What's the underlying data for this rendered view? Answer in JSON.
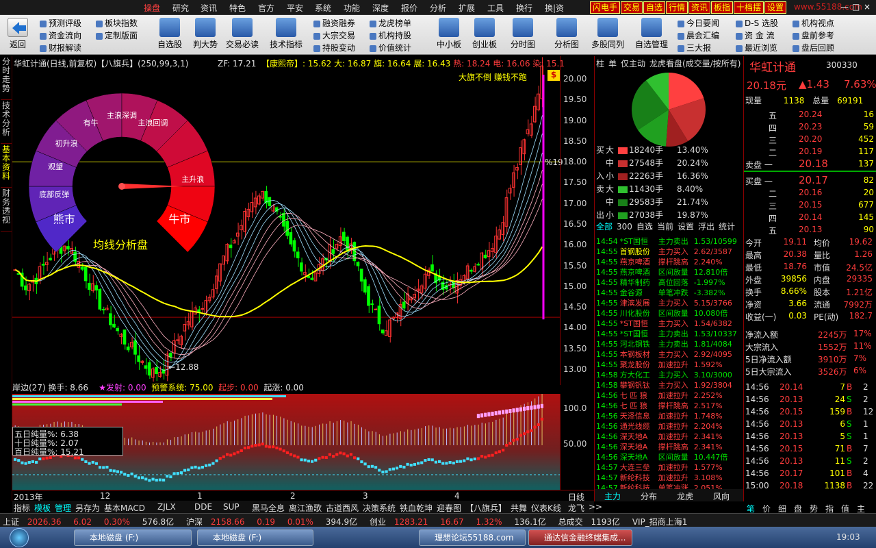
{
  "menu": {
    "items": [
      "操盘",
      "研究",
      "资讯",
      "特色",
      "官方",
      "平安",
      "系统",
      "功能",
      "深度",
      "报价",
      "分析",
      "扩展",
      "工具",
      "换行",
      "换|资"
    ],
    "right_buttons": [
      "闪电手",
      "交易",
      "自选",
      "行情",
      "资讯",
      "板指",
      "十档摆",
      "设置"
    ],
    "watermark": "www.55188.com",
    "window_controls": [
      "—",
      "□",
      "×"
    ]
  },
  "toolbar": {
    "back": "返回",
    "smalls": [
      [
        "预测评级",
        "资金流向",
        "财报解读"
      ],
      [
        "板块指数",
        "定制版面"
      ],
      [
        "融资融券",
        "大宗交易",
        "持股变动"
      ],
      [
        "龙虎榜单",
        "机构持股",
        "价值统计"
      ],
      [
        "今日要闻",
        "晨会汇编",
        "三大报"
      ],
      [
        "D-S 选股",
        "资 金 流",
        "最近浏览"
      ],
      [
        "机构视点",
        "盘前参考",
        "盘后回顾"
      ]
    ],
    "bigs": [
      "自选股",
      "判大势",
      "交易必读",
      "技术指标",
      "中小板",
      "创业板",
      "分时图",
      "分析图",
      "多股同列",
      "自选管理"
    ]
  },
  "left_tabs": [
    "分时走势",
    "技术分析",
    "基本资料",
    "财务透视"
  ],
  "chart": {
    "title": "华虹计通(日线,前复权)【八旗兵】(250,99,3,1)",
    "zf": "ZF: 17.21",
    "kangxi": "【康熙帝】: 15.62",
    "da": "大: 16.87",
    "qi": "旗: 16.64",
    "zhan": "展: 16.43",
    "re": "热: 18.24",
    "dian": "电: 16.06",
    "ran": "染: 15.1",
    "slogan": "大旗不倒 赚钱不跑",
    "gauge_title": "均线分析盘",
    "gauge_labels": [
      "熊市",
      "底部反弹",
      "观望",
      "初升浪",
      "有牛",
      "主浪深调",
      "主浪回调",
      "主升浪",
      "牛市"
    ],
    "low_marker": "12.88",
    "pct_marker": "%19",
    "y_axis": [
      "20.00",
      "19.50",
      "19.00",
      "18.50",
      "18.00",
      "17.50",
      "17.00",
      "16.50",
      "16.00",
      "15.50",
      "15.00",
      "14.50",
      "14.00",
      "13.50",
      "13.00"
    ]
  },
  "chart_data": {
    "type": "candlestick",
    "y_range": [
      12.7,
      20.3
    ],
    "dates": [
      "2013年",
      "12",
      "1",
      "2",
      "3",
      "4"
    ]
  },
  "indicator": {
    "header": "岸边(27) 换手: 8.66",
    "fashe": "★发射: 0.00",
    "yujing": "预警系统: 75.00",
    "qibu": "起步: 0.00",
    "qizhang": "起涨: 0.00",
    "box": [
      "五日纯量%: 6.38",
      "十日纯量%: 2.07",
      "百日纯量%: 15.21"
    ],
    "axis": [
      "100.0",
      "50.00"
    ]
  },
  "bottom_tabs": [
    "指标",
    "模板",
    "管理",
    "另存为",
    "基本MACD",
    "ZJLX",
    "DDE",
    "SUP",
    "黑马全息",
    "离江渔歌",
    "古道西风",
    "决策系统",
    "铁血乾坤",
    "迎春图",
    "【八旗兵】",
    "共舞",
    "仪表K线",
    "龙飞",
    ">>"
  ],
  "day_label": "日线",
  "middle": {
    "header": [
      "柱",
      "单",
      "仅主动",
      "龙虎看盘(成交量/按所有)"
    ],
    "buy_sell": [
      {
        "side": "买",
        "size": "大",
        "vol": "18240手",
        "pct": "13.40%"
      },
      {
        "side": "",
        "size": "中",
        "vol": "27548手",
        "pct": "20.24%"
      },
      {
        "side": "入",
        "size": "小",
        "vol": "22263手",
        "pct": "16.36%"
      },
      {
        "side": "卖",
        "size": "大",
        "vol": "11430手",
        "pct": "8.40%"
      },
      {
        "side": "",
        "size": "中",
        "vol": "29583手",
        "pct": "21.74%"
      },
      {
        "side": "出",
        "size": "小",
        "vol": "27038手",
        "pct": "19.87%"
      }
    ],
    "filter": [
      "全部",
      "300",
      "自选",
      "当前",
      "设置",
      "浮出",
      "统计"
    ],
    "events": [
      [
        "14:54",
        "*ST国恒",
        "主力卖出",
        "1.53/10599",
        "g"
      ],
      [
        "14:55",
        "首钢股份",
        "主力买入",
        "2.62/3587",
        "r"
      ],
      [
        "14:55",
        "燕京啤酒",
        "撑杆跳高",
        "2.240%",
        "r"
      ],
      [
        "14:55",
        "燕京啤酒",
        "区间放量",
        "12.810倍",
        "g"
      ],
      [
        "14:55",
        "精华制药",
        "高位回落",
        "-1.997%",
        "g"
      ],
      [
        "14:55",
        "金谷源",
        "单笔冲跌",
        "-3.382%",
        "g"
      ],
      [
        "14:55",
        "津滨发展",
        "主力买入",
        "5.15/3766",
        "r"
      ],
      [
        "14:55",
        "川化股份",
        "区间放量",
        "10.080倍",
        "g"
      ],
      [
        "14:55",
        "*ST国恒",
        "主力买入",
        "1.54/6382",
        "r"
      ],
      [
        "14:55",
        "*ST国恒",
        "主力卖出",
        "1.53/10337",
        "g"
      ],
      [
        "14:55",
        "河北钢铁",
        "主力卖出",
        "1.81/4084",
        "g"
      ],
      [
        "14:55",
        "本钢板材",
        "主力买入",
        "2.92/4095",
        "r"
      ],
      [
        "14:55",
        "聚龙股份",
        "加速拉升",
        "1.592%",
        "r"
      ],
      [
        "14:58",
        "方大化工",
        "主力买入",
        "3.10/3000",
        "g"
      ],
      [
        "14:58",
        "攀钢钒钛",
        "主力买入",
        "1.92/3804",
        "r"
      ],
      [
        "14:56",
        "七 匹 狼",
        "加速拉升",
        "2.252%",
        "r"
      ],
      [
        "14:56",
        "七 匹 狼",
        "撑杆跳高",
        "2.517%",
        "r"
      ],
      [
        "14:56",
        "天泽信息",
        "加速拉升",
        "1.748%",
        "r"
      ],
      [
        "14:56",
        "通光线缆",
        "加速拉升",
        "2.204%",
        "r"
      ],
      [
        "14:56",
        "深天地A",
        "加速拉升",
        "2.341%",
        "r"
      ],
      [
        "14:56",
        "深天地A",
        "撑杆跳高",
        "2.341%",
        "r"
      ],
      [
        "14:56",
        "深天地A",
        "区间放量",
        "10.447倍",
        "g"
      ],
      [
        "14:57",
        "大连三垒",
        "加速拉升",
        "1.577%",
        "r"
      ],
      [
        "14:57",
        "新纶科技",
        "加速拉升",
        "3.108%",
        "r"
      ],
      [
        "14:57",
        "新纶科技",
        "单笔冲涨",
        "2.051%",
        "r"
      ]
    ],
    "tabs": [
      "主力",
      "分布",
      "龙虎",
      "风向"
    ]
  },
  "quote": {
    "name": "华虹计通",
    "code": "300330",
    "price": "20.18元",
    "change": "▲1.43",
    "pct": "7.63%",
    "xianshou": "现量",
    "xianshou_v": "1138",
    "zongliang": "总量",
    "zongliang_v": "69191",
    "sells": [
      [
        "五",
        "20.24",
        "16"
      ],
      [
        "四",
        "20.23",
        "59"
      ],
      [
        "三",
        "20.20",
        "452"
      ],
      [
        "二",
        "20.19",
        "117"
      ],
      [
        "卖盘 一",
        "20.18",
        "137"
      ]
    ],
    "buys": [
      [
        "买盘 一",
        "20.17",
        "82"
      ],
      [
        "二",
        "20.16",
        "20"
      ],
      [
        "三",
        "20.15",
        "677"
      ],
      [
        "四",
        "20.14",
        "145"
      ],
      [
        "五",
        "20.13",
        "90"
      ]
    ],
    "stats": [
      [
        "今开",
        "19.11",
        "均价",
        "19.62"
      ],
      [
        "最高",
        "20.38",
        "量比",
        "1.26"
      ],
      [
        "最低",
        "18.76",
        "市值",
        "24.5亿"
      ],
      [
        "外盘",
        "39856",
        "内盘",
        "29335"
      ],
      [
        "换手",
        "8.66%",
        "股本",
        "1.21亿"
      ],
      [
        "净资",
        "3.66",
        "流通",
        "7992万"
      ],
      [
        "收益(一)",
        "0.03",
        "PE(动)",
        "182.7"
      ]
    ],
    "flows": [
      [
        "净流入额",
        "2245万",
        "17%"
      ],
      [
        "大宗流入",
        "1552万",
        "11%"
      ],
      [
        "5日净流入额",
        "3910万",
        "7%"
      ],
      [
        "5日大宗流入",
        "3526万",
        "6%"
      ]
    ],
    "ticks": [
      [
        "14:56",
        "20.14",
        "7",
        "B",
        "2"
      ],
      [
        "14:56",
        "20.13",
        "24",
        "S",
        "2"
      ],
      [
        "14:56",
        "20.15",
        "159",
        "B",
        "12"
      ],
      [
        "14:56",
        "20.13",
        "6",
        "S",
        "1"
      ],
      [
        "14:56",
        "20.13",
        "5",
        "S",
        "1"
      ],
      [
        "14:56",
        "20.15",
        "71",
        "B",
        "7"
      ],
      [
        "14:56",
        "20.13",
        "11",
        "S",
        "2"
      ],
      [
        "14:56",
        "20.17",
        "101",
        "B",
        "4"
      ],
      [
        "15:00",
        "20.18",
        "1138",
        "B",
        "22"
      ]
    ],
    "tabs": [
      "笔",
      "价",
      "细",
      "盘",
      "势",
      "指",
      "值",
      "主"
    ]
  },
  "status": {
    "sh": "上证",
    "sh_v": "2026.36",
    "sh_c": "6.02",
    "sh_p": "0.30%",
    "sh_a": "576.8亿",
    "hs": "沪深",
    "hs_v": "2158.66",
    "hs_c": "0.19",
    "hs_p": "0.01%",
    "hs_a": "394.9亿",
    "cy": "创业",
    "cy_v": "1283.21",
    "cy_c": "16.67",
    "cy_p": "1.32%",
    "cy_a": "136.1亿",
    "total": "总成交",
    "total_v": "1193亿",
    "vip": "VIP_招商上海1"
  },
  "taskbar": {
    "items": [
      "本地磁盘 (F:)",
      "本地磁盘 (F:)",
      "理想论坛55188.com",
      "通达信金融终端集成..."
    ],
    "time": "19:03"
  }
}
